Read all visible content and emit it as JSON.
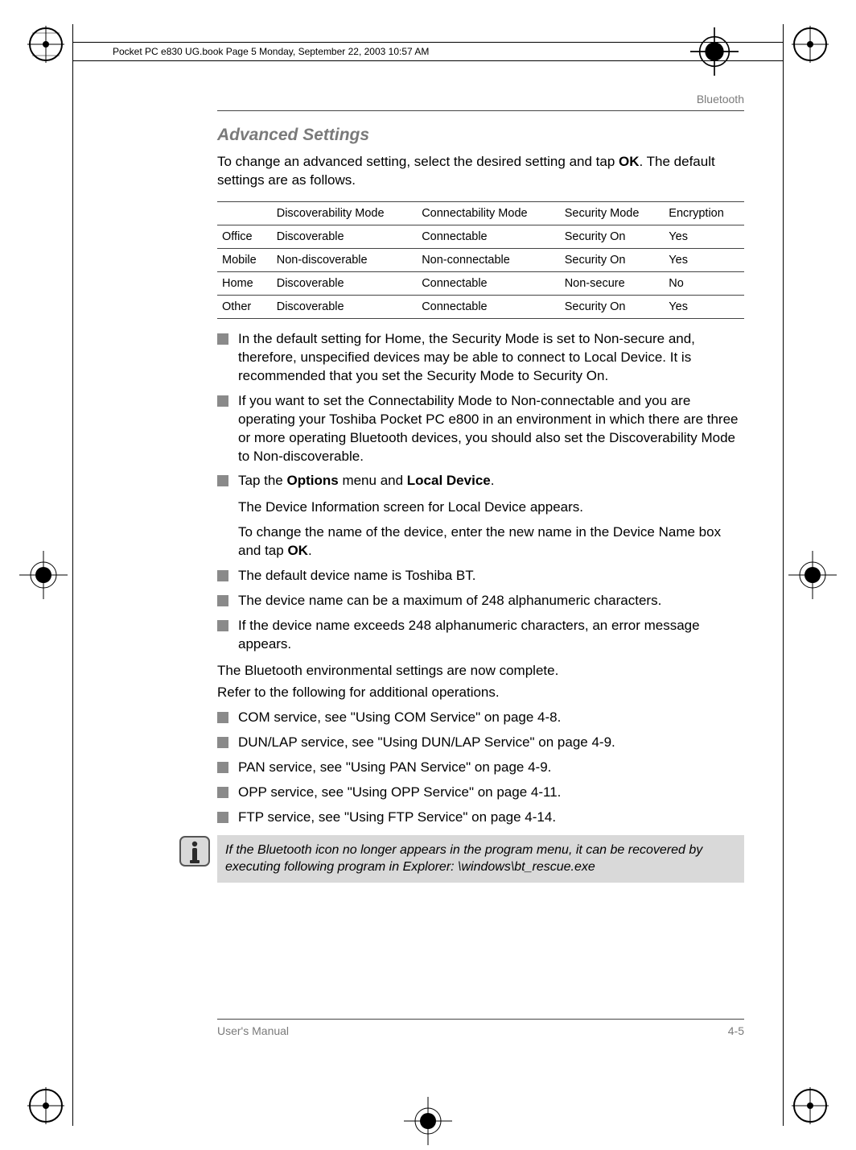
{
  "header": {
    "running_head": "Pocket PC e830 UG.book  Page 5  Monday, September 22, 2003  10:57 AM"
  },
  "breadcrumb": "Bluetooth",
  "section_title": "Advanced Settings",
  "intro": "To change an advanced setting, select the desired setting and tap OK. The default settings are as follows.",
  "table": {
    "headers": [
      "",
      "Discoverability Mode",
      "Connectability Mode",
      "Security Mode",
      "Encryption"
    ],
    "rows": [
      [
        "Office",
        "Discoverable",
        "Connectable",
        "Security On",
        "Yes"
      ],
      [
        "Mobile",
        "Non-discoverable",
        "Non-connectable",
        "Security On",
        "Yes"
      ],
      [
        "Home",
        "Discoverable",
        "Connectable",
        "Non-secure",
        "No"
      ],
      [
        "Other",
        "Discoverable",
        "Connectable",
        "Security On",
        "Yes"
      ]
    ]
  },
  "bullets1": [
    "In the default setting for Home, the Security Mode is set to Non-secure and, therefore, unspecified devices may be able to connect to Local Device. It is recommended that you set the Security Mode to Security On.",
    "If you want to set the Connectability Mode to Non-connectable and you are operating your Toshiba Pocket PC e800 in an environment in which there are three or more operating Bluetooth devices, you should also set the Discoverability Mode to Non-discoverable."
  ],
  "bullet_options_pre": "Tap the ",
  "bullet_options_b1": "Options",
  "bullet_options_mid": " menu and ",
  "bullet_options_b2": "Local Device",
  "bullet_options_post": ".",
  "sub1": "The Device Information screen for Local Device appears.",
  "sub2_pre": "To change the name of the device, enter the new name in the Device Name box and tap ",
  "sub2_b": "OK",
  "sub2_post": ".",
  "bullets2": [
    "The default device name is Toshiba BT.",
    "The device name can be a maximum of 248 alphanumeric characters.",
    "If the device name exceeds 248 alphanumeric characters, an error message appears."
  ],
  "para1": "The Bluetooth environmental settings are now complete.",
  "para2": "Refer to the following for additional operations.",
  "bullets3": [
    "COM service, see \"Using COM Service\" on page 4-8.",
    "DUN/LAP service, see \"Using DUN/LAP Service\" on page 4-9.",
    "PAN service, see \"Using PAN Service\" on page 4-9.",
    "OPP service, see \"Using OPP Service\" on page 4-11.",
    "FTP service, see \"Using FTP Service\" on page 4-14."
  ],
  "info": "If the Bluetooth icon no longer appears in the program menu, it can be recovered by executing following program in Explorer: \\windows\\bt_rescue.exe",
  "footer": {
    "left": "User's Manual",
    "right": "4-5"
  }
}
